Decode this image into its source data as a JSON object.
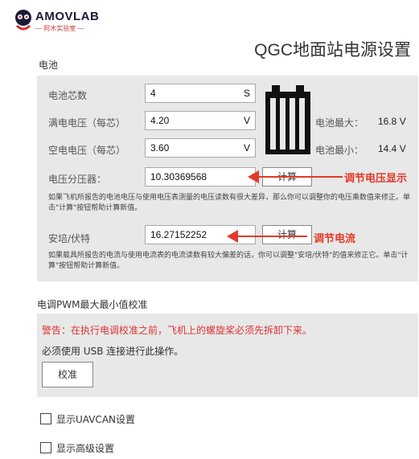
{
  "brand": {
    "name": "AMOVLAB",
    "tagline": "— 阿木实验室 —"
  },
  "page_title": "QGC地面站电源设置",
  "battery": {
    "section_label": "电池",
    "cells_label": "电池芯数",
    "cells_value": "4",
    "cells_unit": "S",
    "full_label": "满电电压（每芯）",
    "full_value": "4.20",
    "full_unit": "V",
    "empty_label": "空电电压（每芯）",
    "empty_value": "3.60",
    "empty_unit": "V",
    "max_label": "电池最大：",
    "max_value": "16.8 V",
    "min_label": "电池最小：",
    "min_value": "14.4 V",
    "divider_label": "电压分压器：",
    "divider_value": "10.30369568",
    "divider_btn": "计算",
    "divider_note": "如果飞机所报告的电池电压与使用电压表测量的电压读数有很大差异，那么你可以调整你的电压乘数值来修正。单击\"计算\"按钮帮助计算新值。",
    "amps_label": "安培/伏特",
    "amps_value": "16.27152252",
    "amps_btn": "计算",
    "amps_note": "如果载具所报告的电流与使用电流表的电流读数有较大偏差的话，你可以调整\"安培/伏特\"的值来修正它。单击\"计算\"按钮帮助计算新值。",
    "anno_voltage": "调节电压显示",
    "anno_current": "调节电流",
    "color_accent": "#e23a2a"
  },
  "esc": {
    "section_label": "电调PWM最大最小值校准",
    "warning": "警告：在执行电调校准之前，飞机上的螺旋桨必须先拆卸下来。",
    "usb_note": "必须使用 USB 连接进行此操作。",
    "calibrate_btn": "校准"
  },
  "options": {
    "uavcan_label": "显示UAVCAN设置",
    "advanced_label": "显示高级设置"
  }
}
